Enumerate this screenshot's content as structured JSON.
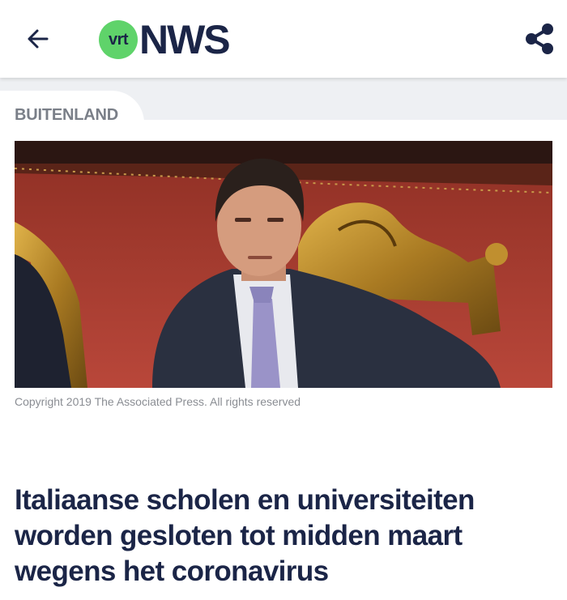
{
  "header": {
    "back_icon": "arrow-left-icon",
    "logo_badge": "vrt",
    "logo_text": "NWS",
    "share_icon": "share-icon",
    "brand_green": "#5fd36a",
    "brand_navy": "#1b2547"
  },
  "article": {
    "section": "BUITENLAND",
    "image_caption": "Copyright 2019 The Associated Press. All rights reserved",
    "headline": "Italiaanse scholen en universiteiten worden gesloten tot midden maart wegens het coronavirus"
  }
}
